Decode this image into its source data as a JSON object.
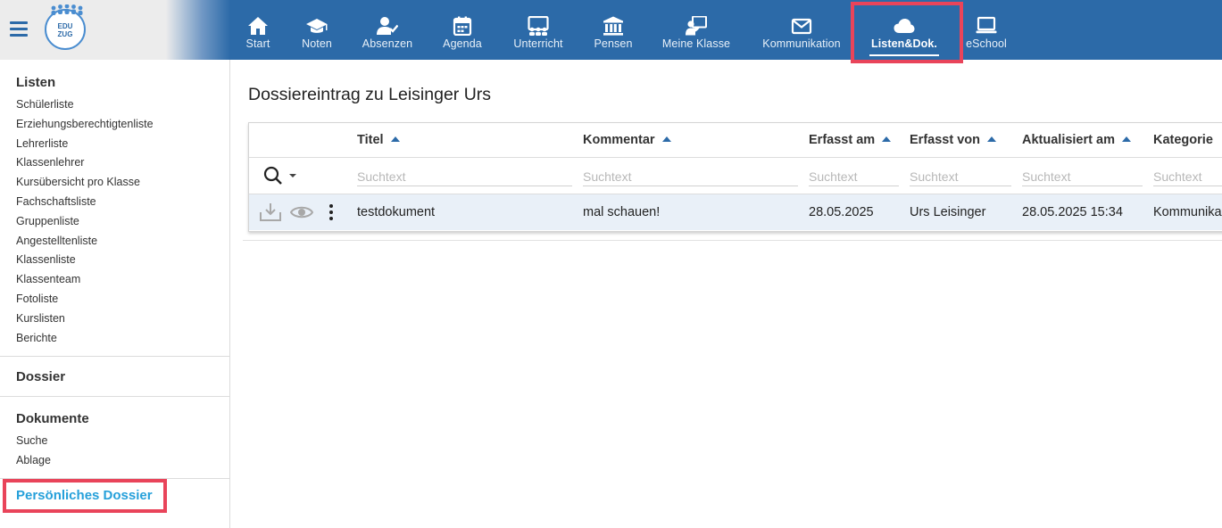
{
  "header": {
    "logo_text": "EDU\nZUG",
    "nav": [
      {
        "label": "Start",
        "icon": "home-icon"
      },
      {
        "label": "Noten",
        "icon": "graduation-cap-icon"
      },
      {
        "label": "Absenzen",
        "icon": "user-check-icon"
      },
      {
        "label": "Agenda",
        "icon": "calendar-icon"
      },
      {
        "label": "Unterricht",
        "icon": "classroom-icon"
      },
      {
        "label": "Pensen",
        "icon": "institution-icon"
      },
      {
        "label": "Meine Klasse",
        "icon": "teacher-board-icon"
      },
      {
        "label": "Kommunikation",
        "icon": "envelope-icon"
      },
      {
        "label": "Listen&Dok.",
        "icon": "cloud-icon",
        "active": true
      },
      {
        "label": "eSchool",
        "icon": "laptop-icon"
      }
    ]
  },
  "sidebar": {
    "listen": {
      "heading": "Listen",
      "items": [
        "Schülerliste",
        "Erziehungsberechtigtenliste",
        "Lehrerliste",
        "Klassenlehrer",
        "Kursübersicht pro Klasse",
        "Fachschaftsliste",
        "Gruppenliste",
        "Angestelltenliste",
        "Klassenliste",
        "Klassenteam",
        "Fotoliste",
        "Kurslisten",
        "Berichte"
      ]
    },
    "dossier": {
      "heading": "Dossier"
    },
    "dokumente": {
      "heading": "Dokumente",
      "items": [
        "Suche",
        "Ablage"
      ]
    },
    "personal": "Persönliches Dossier"
  },
  "main": {
    "title": "Dossiereintrag zu Leisinger Urs",
    "columns": [
      "Titel",
      "Kommentar",
      "Erfasst am",
      "Erfasst von",
      "Aktualisiert am",
      "Kategorie"
    ],
    "filter_placeholder": "Suchtext",
    "rows": [
      {
        "titel": "testdokument",
        "kommentar": "mal schauen!",
        "erfasst_am": "28.05.2025",
        "erfasst_von": "Urs Leisinger",
        "aktualisiert_am": "28.05.2025 15:34",
        "kategorie": "Kommunika"
      }
    ]
  },
  "colors": {
    "header_blue": "#2c6aa8",
    "accent": "#26a0da",
    "highlight": "#e9445a",
    "row_bg": "#e9f0f8"
  }
}
